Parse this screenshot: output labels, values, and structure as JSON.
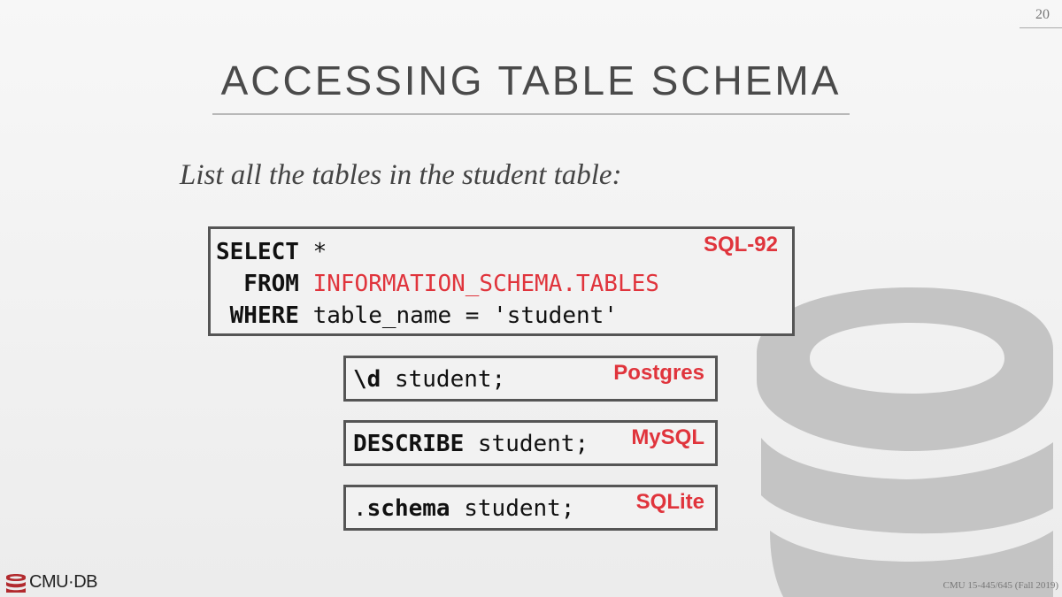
{
  "slide": {
    "page_number": "20",
    "title": "ACCESSING TABLE SCHEMA",
    "subtitle": "List all the tables in the student table:"
  },
  "sql92": {
    "tag": "SQL-92",
    "line1_kw": "SELECT",
    "line1_rest": " *",
    "line2_kw": "  FROM",
    "line2_rest": " INFORMATION_SCHEMA.TABLES",
    "line3_kw": " WHERE",
    "line3_rest": " table_name = 'student'"
  },
  "postgres": {
    "tag": "Postgres",
    "kw": "\\d",
    "rest": " student;"
  },
  "mysql": {
    "tag": "MySQL",
    "kw": "DESCRIBE",
    "rest": " student;"
  },
  "sqlite": {
    "tag": "SQLite",
    "kw_prefix": ".",
    "kw": "schema",
    "rest": " student;"
  },
  "footer": {
    "logo_text": "CMU·DB",
    "course": "CMU 15-445/645 (Fall 2019)"
  },
  "colors": {
    "accent_red": "#e0343c",
    "logo_gray": "#c4c4c4",
    "logo_red": "#b22a2e"
  },
  "icons": {
    "background_logo": "database-cylinder-icon",
    "footer_logo": "database-icon"
  }
}
